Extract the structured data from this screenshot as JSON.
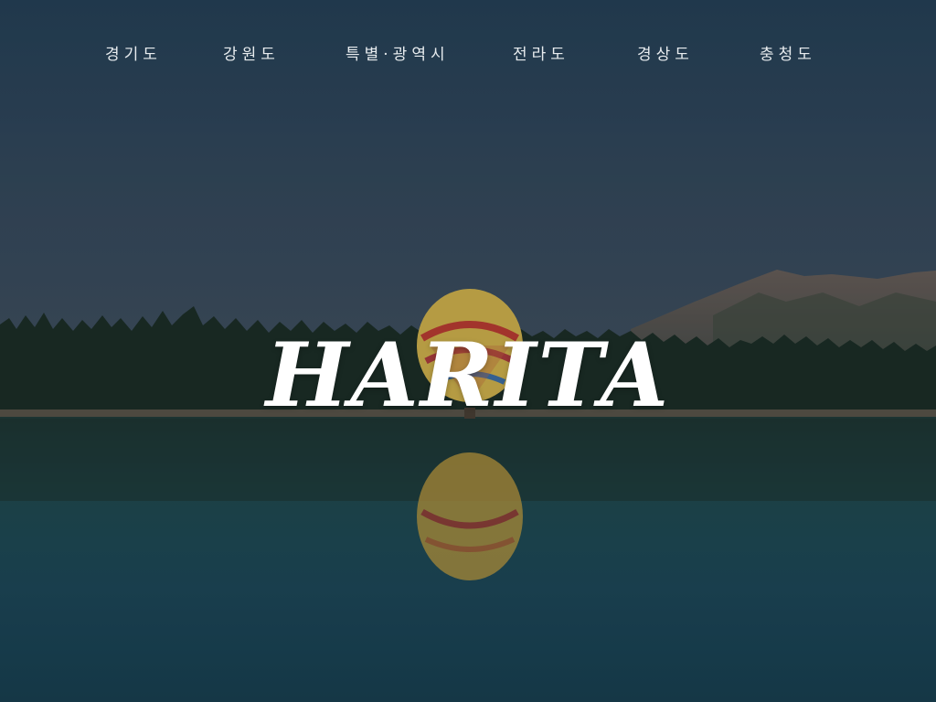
{
  "nav": {
    "items": [
      {
        "label": "경기도"
      },
      {
        "label": "강원도"
      },
      {
        "label": "특별·광역시"
      },
      {
        "label": "전라도"
      },
      {
        "label": "경상도"
      },
      {
        "label": "충청도"
      }
    ]
  },
  "hero": {
    "title": "HARITA",
    "image": "lake-hot-air-balloon-forest-mountain"
  },
  "colors": {
    "sky_top": "#2a4457",
    "sky_bottom": "#3f4d5e",
    "forest": "#1a2a1f",
    "water": "#1c4a55",
    "text": "#ffffff"
  }
}
